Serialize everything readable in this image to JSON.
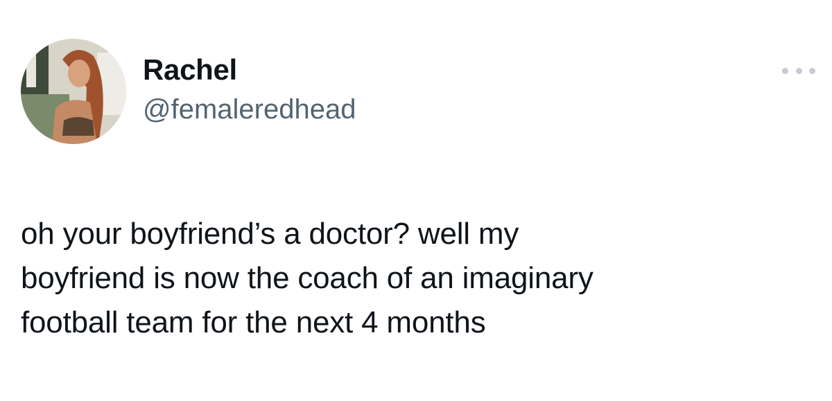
{
  "author": {
    "display_name": "Rachel",
    "handle": "@femaleredhead",
    "avatar_icon": "profile-photo"
  },
  "menu": {
    "icon": "more-options-icon"
  },
  "tweet": {
    "text": "oh your boyfriend’s a doctor? well my\nboyfriend is now the coach of an imaginary\nfootball team for the next 4 months"
  },
  "colors": {
    "primary_text": "#0f1419",
    "secondary_text": "#536471",
    "background": "#ffffff"
  }
}
